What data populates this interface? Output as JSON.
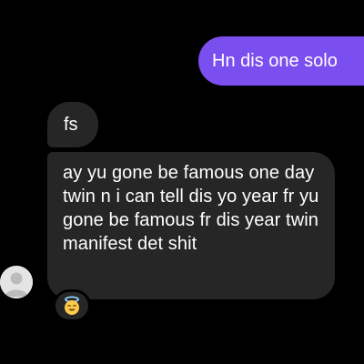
{
  "conversation": {
    "messages": [
      {
        "sender": "me",
        "text": "Hn dis one solo"
      },
      {
        "sender": "them",
        "text": "fs"
      },
      {
        "sender": "them",
        "text": "ay yu gone be famous one day twin n i can tell dis yo year fr yu gone be famous fr dis year twin manifest det shit"
      }
    ],
    "reaction": {
      "icon": "smiling-face-with-halo-emoji"
    },
    "avatar": {
      "icon": "default-profile-icon"
    }
  },
  "colors": {
    "background": "#000000",
    "sent_bubble": "#7b4ef0",
    "received_bubble": "#262626",
    "text": "#ffffff"
  }
}
